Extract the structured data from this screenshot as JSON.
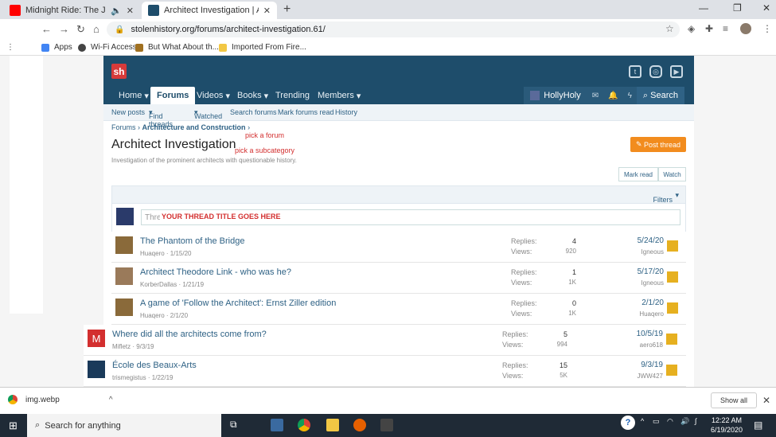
{
  "browser": {
    "tabs": [
      {
        "title": "Midnight Ride: The Judgmen",
        "icon": "youtube-icon",
        "color": "#ff0000"
      },
      {
        "title": "Architect Investigation | Alternati",
        "icon": "sh-favicon",
        "color": "#1e4d6b"
      }
    ],
    "url": "stolenhistory.org/forums/architect-investigation.61/",
    "bookmarks": [
      "Apps",
      "Wi-Fi Access",
      "But What About th...",
      "Imported From Fire..."
    ]
  },
  "site": {
    "logo": "sh",
    "nav": [
      "Home",
      "Forums",
      "Videos",
      "Books",
      "Trending",
      "Members"
    ],
    "username": "HollyHoly",
    "search_label": "Search",
    "subnav": [
      "New posts",
      "Find threads",
      "Watched",
      "Search forums",
      "Mark forums read",
      "History"
    ]
  },
  "page": {
    "breadcrumb_root": "Forums",
    "breadcrumb_current": "Architecture and Construction",
    "title": "Architect Investigation",
    "description": "Investigation of the prominent architects with questionable history.",
    "annotation_forum": "pick a forum",
    "annotation_subcategory": "pick a subcategory",
    "post_thread": "Post thread",
    "mark_read": "Mark read",
    "watch": "Watch",
    "filters": "Filters",
    "thread_placeholder": "Thre",
    "thread_overlay": "YOUR THREAD TITLE GOES HERE",
    "replies_label": "Replies:",
    "views_label": "Views:"
  },
  "threads": [
    {
      "title": "The Phantom of the Bridge",
      "author": "Huaqero",
      "date": "1/15/20",
      "replies": "4",
      "views": "920",
      "last_date": "5/24/20",
      "last_user": "Igneous",
      "avatar_color": "#8a6a3a"
    },
    {
      "title": "Architect Theodore Link - who was he?",
      "author": "KorberDallas",
      "date": "1/21/19",
      "replies": "1",
      "views": "1K",
      "last_date": "5/17/20",
      "last_user": "Igneous",
      "avatar_color": "#9a7a5a"
    },
    {
      "title": "A game of 'Follow the Architect': Ernst Ziller edition",
      "author": "Huaqero",
      "date": "2/1/20",
      "replies": "0",
      "views": "1K",
      "last_date": "2/1/20",
      "last_user": "Huaqero",
      "avatar_color": "#8a6a3a"
    },
    {
      "title": "Where did all the architects come from?",
      "author": "Mifletz",
      "date": "9/3/19",
      "replies": "5",
      "views": "994",
      "last_date": "10/5/19",
      "last_user": "aero618",
      "avatar_color": "#d32f2f",
      "letter": "M"
    },
    {
      "title": "École des Beaux-Arts",
      "author": "trismegistus",
      "date": "1/22/19",
      "replies": "15",
      "views": "5K",
      "last_date": "9/3/19",
      "last_user": "JWW427",
      "avatar_color": "#1a3a5a"
    }
  ],
  "downloads": {
    "file": "img.webp",
    "show_all": "Show all"
  },
  "taskbar": {
    "search_placeholder": "Search for anything",
    "time": "12:22 AM",
    "date": "6/19/2020"
  }
}
